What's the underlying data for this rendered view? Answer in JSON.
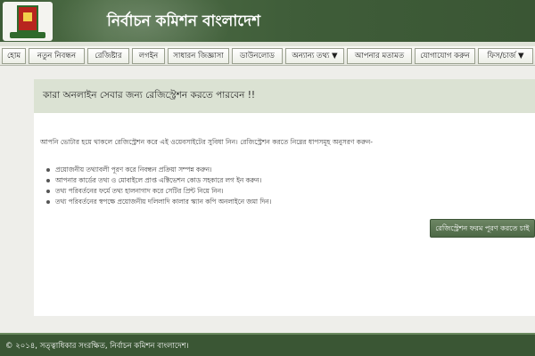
{
  "header": {
    "site_title": "নির্বাচন কমিশন বাংলাদেশ",
    "logo_icon": "election-commission-seal-icon"
  },
  "nav": {
    "items": [
      {
        "label": "হোম"
      },
      {
        "label": "নতুন নিবন্ধন"
      },
      {
        "label": "রেজিষ্টার"
      },
      {
        "label": "লগইন"
      },
      {
        "label": "সাধারন জিজ্ঞাসা"
      },
      {
        "label": "ডাউনলোড"
      },
      {
        "label": "অন্যান্য তথ্য ▼"
      },
      {
        "label": "আপনার মতামত"
      },
      {
        "label": "যোগাযোগ করুন"
      },
      {
        "label": "ফিস/চার্জ ▼"
      }
    ]
  },
  "main": {
    "notice": "কারা অনলাইন সেবার জন্য রেজিস্ট্রেশন করতে পারবেন !!",
    "intro": "আপনি ভোটার হয়ে থাকলে রেজিস্ট্রেশন করে এই ওয়েবসাইটের সুবিধা নিন। রেজিস্ট্রেশন করতে নিম্নের ধাপসমূহ অনুসরণ করুন-",
    "steps": [
      "প্রয়োজনীয় তথ্যাবলী পূরণ করে নিবন্ধন প্রক্রিয়া সম্পন্ন করুন।",
      "আপনার কার্ডের তথ্য ও মোবাইলে প্রাপ্ত এক্টিভেশন কোড সহকারে লগ ইন করুন।",
      "তথ্য পরিবর্তনের ফর্মে তথ্য হালনাগাদ করে সেটির প্রিন্ট নিয়ে নিন।",
      "তথ্য পরিবর্তনের স্বপক্ষে প্রয়োজনীয় দলিলাদি কালার স্ক্যান কপি অনলাইনে জমা দিন।"
    ],
    "register_button": "রেজিস্ট্রেশন ফরম পূরণ করতে চাই"
  },
  "footer": {
    "copyright": "© ২০১৪, সত্ত্বাধিকার সংরক্ষিত, নির্বাচন কমিশন বাংলাদেশ।"
  },
  "colors": {
    "header_green": "#3d5c37",
    "notice_bg": "#dbe2d3",
    "button_green": "#5a7652",
    "page_bg": "#eeeeea"
  }
}
